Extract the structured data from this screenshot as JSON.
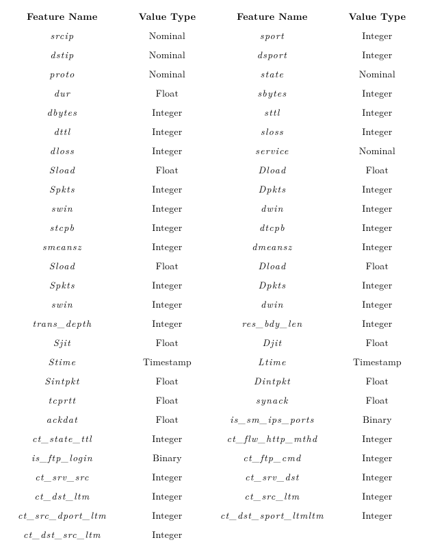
{
  "chart_data": {
    "type": "table",
    "title": "",
    "columns": [
      "Feature Name",
      "Value Type",
      "Feature Name",
      "Value Type"
    ],
    "rows": [
      [
        "srcip",
        "Nominal",
        "sport",
        "Integer"
      ],
      [
        "dstip",
        "Nominal",
        "dsport",
        "Integer"
      ],
      [
        "proto",
        "Nominal",
        "state",
        "Nominal"
      ],
      [
        "dur",
        "Float",
        "sbytes",
        "Integer"
      ],
      [
        "dbytes",
        "Integer",
        "sttl",
        "Integer"
      ],
      [
        "dttl",
        "Integer",
        "sloss",
        "Integer"
      ],
      [
        "dloss",
        "Integer",
        "service",
        "Nominal"
      ],
      [
        "Sload",
        "Float",
        "Dload",
        "Float"
      ],
      [
        "Spkts",
        "Integer",
        "Dpkts",
        "Integer"
      ],
      [
        "swin",
        "Integer",
        "dwin",
        "Integer"
      ],
      [
        "stcpb",
        "Integer",
        "dtcpb",
        "Integer"
      ],
      [
        "smeansz",
        "Integer",
        "dmeansz",
        "Integer"
      ],
      [
        "Sload",
        "Float",
        "Dload",
        "Float"
      ],
      [
        "Spkts",
        "Integer",
        "Dpkts",
        "Integer"
      ],
      [
        "swin",
        "Integer",
        "dwin",
        "Integer"
      ],
      [
        "trans_depth",
        "Integer",
        "res_bdy_len",
        "Integer"
      ],
      [
        "Sjit",
        "Float",
        "Djit",
        "Float"
      ],
      [
        "Stime",
        "Timestamp",
        "Ltime",
        "Timestamp"
      ],
      [
        "Sintpkt",
        "Float",
        "Dintpkt",
        "Float"
      ],
      [
        "tcprtt",
        "Float",
        "synack",
        "Float"
      ],
      [
        "ackdat",
        "Float",
        "is_sm_ips_ports",
        "Binary"
      ],
      [
        "ct_state_ttl",
        "Integer",
        "ct_flw_http_mthd",
        "Integer"
      ],
      [
        "is_ftp_login",
        "Binary",
        "ct_ftp_cmd",
        "Integer"
      ],
      [
        "ct_srv_src",
        "Integer",
        "ct_srv_dst",
        "Integer"
      ],
      [
        "ct_dst_ltm",
        "Integer",
        "ct_src_ltm",
        "Integer"
      ],
      [
        "ct_src_dport_ltm",
        "Integer",
        "ct_dst_sport_ltmltm",
        "Integer"
      ],
      [
        "ct_dst_src_ltm",
        "Integer",
        "",
        ""
      ]
    ]
  }
}
